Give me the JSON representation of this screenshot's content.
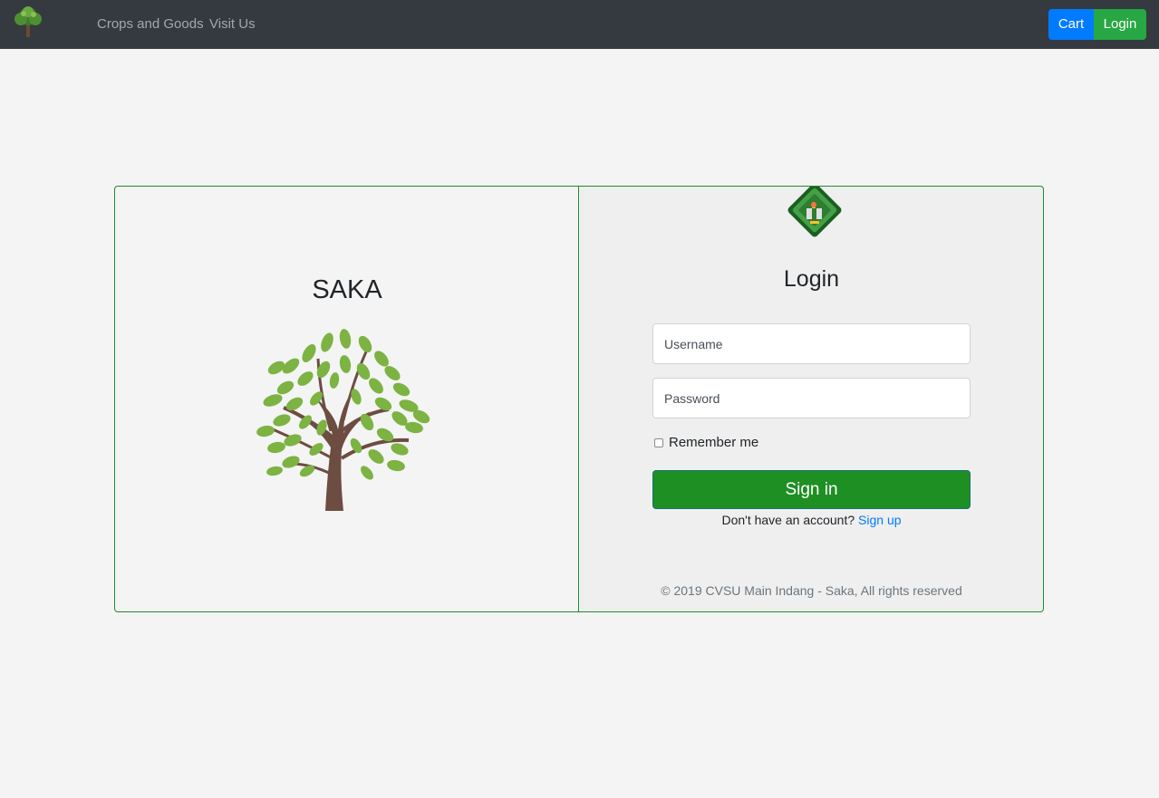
{
  "navbar": {
    "logo_icon": "tree-logo-icon",
    "links": [
      "Crops and Goods",
      "Visit Us"
    ],
    "cart_label": "Cart",
    "login_label": "Login",
    "colors": {
      "background": "#343a40",
      "cart": "#007bff",
      "login": "#28a745"
    }
  },
  "brand": {
    "title": "SAKA",
    "illustration": "tree-icon"
  },
  "login_form": {
    "seal_icon": "cvsu-seal-icon",
    "heading": "Login",
    "username_placeholder": "Username",
    "password_placeholder": "Password",
    "remember_label": "Remember me",
    "submit_label": "Sign in",
    "signup_prompt": "Don't have an account?",
    "signup_link": "Sign up",
    "colors": {
      "submit": "#1e8f22",
      "link": "#007bff",
      "border": "#1e8b2e"
    }
  },
  "footer": {
    "text": "© 2019 CVSU Main Indang - Saka, All rights reserved"
  }
}
